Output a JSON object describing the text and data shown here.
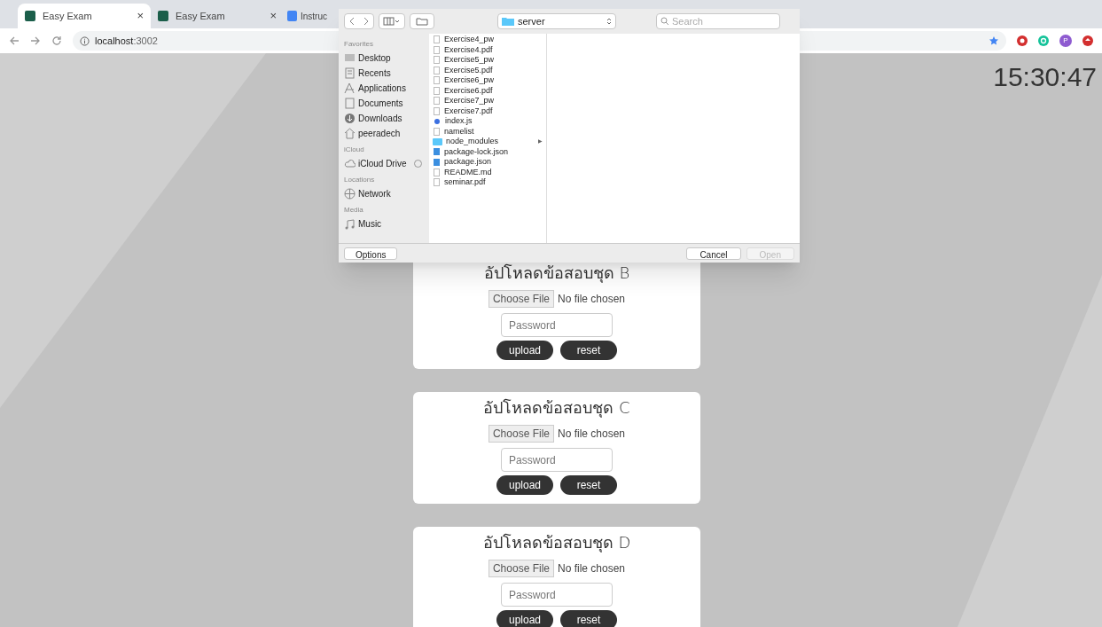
{
  "tabs": [
    {
      "title": "Easy Exam",
      "selected": true,
      "kind": "app",
      "close": "×"
    },
    {
      "title": "Easy Exam",
      "selected": false,
      "kind": "app",
      "close": "×"
    },
    {
      "title": "Instruc",
      "selected": false,
      "kind": "doc"
    }
  ],
  "address": {
    "host": "localhost",
    "port": ":3002"
  },
  "avatar": "P",
  "clock": "15:30:47",
  "cards": [
    {
      "title": "อัปโหลดข้อสอบชุด B",
      "choose": "Choose File",
      "no_file": "No file chosen",
      "placeholder": "Password",
      "upload": "upload",
      "reset": "reset"
    },
    {
      "title": "อัปโหลดข้อสอบชุด C",
      "choose": "Choose File",
      "no_file": "No file chosen",
      "placeholder": "Password",
      "upload": "upload",
      "reset": "reset"
    },
    {
      "title": "อัปโหลดข้อสอบชุด D",
      "choose": "Choose File",
      "no_file": "No file chosen",
      "placeholder": "Password",
      "upload": "upload",
      "reset": "reset"
    }
  ],
  "dialog": {
    "folder": "server",
    "search_placeholder": "Search",
    "sidebar": [
      {
        "heading": "Favorites",
        "items": [
          {
            "label": "Desktop",
            "kind": "desktop"
          },
          {
            "label": "Recents",
            "kind": "recents"
          },
          {
            "label": "Applications",
            "kind": "apps"
          },
          {
            "label": "Documents",
            "kind": "docs"
          },
          {
            "label": "Downloads",
            "kind": "downloads"
          },
          {
            "label": "peeradech",
            "kind": "home"
          }
        ]
      },
      {
        "heading": "iCloud",
        "items": [
          {
            "label": "iCloud Drive",
            "kind": "cloud"
          }
        ]
      },
      {
        "heading": "Locations",
        "items": [
          {
            "label": "Network",
            "kind": "network"
          }
        ]
      },
      {
        "heading": "Media",
        "items": [
          {
            "label": "Music",
            "kind": "music"
          }
        ]
      }
    ],
    "files": [
      {
        "name": "Exercise4_pw",
        "kind": "file"
      },
      {
        "name": "Exercise4.pdf",
        "kind": "file"
      },
      {
        "name": "Exercise5_pw",
        "kind": "file"
      },
      {
        "name": "Exercise5.pdf",
        "kind": "file"
      },
      {
        "name": "Exercise6_pw",
        "kind": "file"
      },
      {
        "name": "Exercise6.pdf",
        "kind": "file"
      },
      {
        "name": "Exercise7_pw",
        "kind": "file"
      },
      {
        "name": "Exercise7.pdf",
        "kind": "file"
      },
      {
        "name": "index.js",
        "kind": "js"
      },
      {
        "name": "namelist",
        "kind": "file"
      },
      {
        "name": "node_modules",
        "kind": "folder",
        "disclosure": "▶"
      },
      {
        "name": "package-lock.json",
        "kind": "json"
      },
      {
        "name": "package.json",
        "kind": "json"
      },
      {
        "name": "README.md",
        "kind": "file"
      },
      {
        "name": "seminar.pdf",
        "kind": "file"
      }
    ],
    "options": "Options",
    "cancel": "Cancel",
    "open": "Open"
  }
}
